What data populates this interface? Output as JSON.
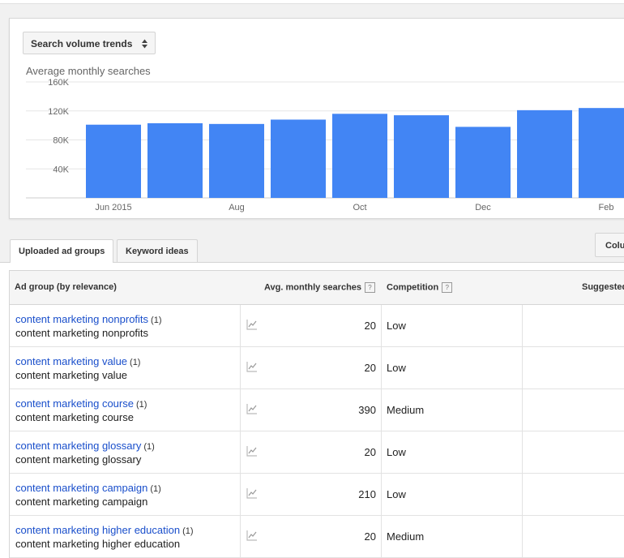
{
  "chart_panel": {
    "dropdown_label": "Search volume trends",
    "chart_title": "Average monthly searches"
  },
  "chart_data": {
    "type": "bar",
    "title": "Average monthly searches",
    "categories": [
      "Jun 2015",
      "Jul 2015",
      "Aug 2015",
      "Sep 2015",
      "Oct 2015",
      "Nov 2015",
      "Dec 2015",
      "Jan 2016",
      "Feb 2016"
    ],
    "x_tick_labels": [
      "Jun 2015",
      "",
      "Aug",
      "",
      "Oct",
      "",
      "Dec",
      "",
      "Feb"
    ],
    "values": [
      101000,
      103000,
      102000,
      108000,
      116000,
      114000,
      98000,
      121000,
      124000
    ],
    "y_ticks": [
      "160K",
      "120K",
      "80K",
      "40K"
    ],
    "ylim": [
      0,
      160000
    ],
    "grid": true,
    "bar_color": "#4285f4"
  },
  "tabs": [
    {
      "label": "Uploaded ad groups",
      "active": true
    },
    {
      "label": "Keyword ideas",
      "active": false
    }
  ],
  "columns_button": "Colu",
  "table": {
    "headers": {
      "ad_group": "Ad group (by relevance)",
      "avg": "Avg. monthly searches",
      "competition": "Competition",
      "suggested": "Suggested",
      "help": "?"
    },
    "rows": [
      {
        "title": "content marketing nonprofits",
        "count": "(1)",
        "keyword": "content marketing nonprofits",
        "searches": "20",
        "competition": "Low"
      },
      {
        "title": "content marketing value",
        "count": "(1)",
        "keyword": "content marketing value",
        "searches": "20",
        "competition": "Low"
      },
      {
        "title": "content marketing course",
        "count": "(1)",
        "keyword": "content marketing course",
        "searches": "390",
        "competition": "Medium"
      },
      {
        "title": "content marketing glossary",
        "count": "(1)",
        "keyword": "content marketing glossary",
        "searches": "20",
        "competition": "Low"
      },
      {
        "title": "content marketing campaign",
        "count": "(1)",
        "keyword": "content marketing campaign",
        "searches": "210",
        "competition": "Low"
      },
      {
        "title": "content marketing higher education",
        "count": "(1)",
        "keyword": "content marketing higher education",
        "searches": "20",
        "competition": "Medium"
      }
    ]
  },
  "colors": {
    "link": "#1a4fcb",
    "bar": "#4285f4"
  }
}
